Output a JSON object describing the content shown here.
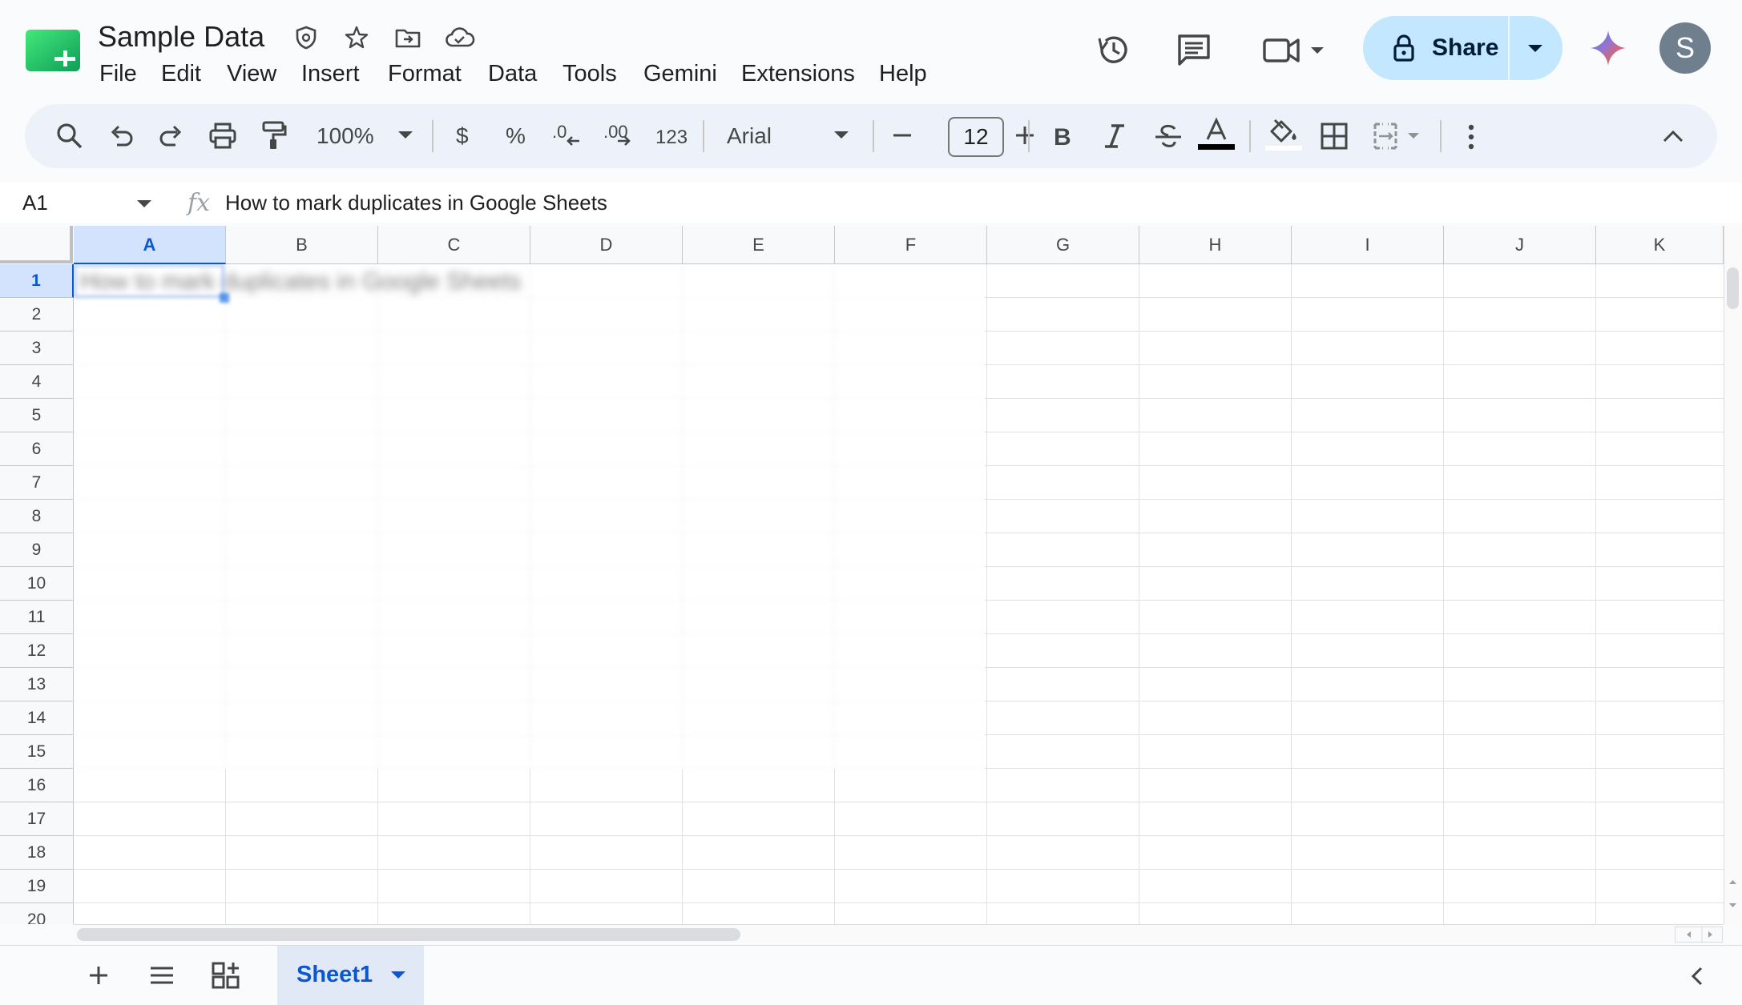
{
  "document": {
    "title": "Sample Data"
  },
  "menu": [
    "File",
    "Edit",
    "View",
    "Insert",
    "Format",
    "Data",
    "Tools",
    "Gemini",
    "Extensions",
    "Help"
  ],
  "share": {
    "label": "Share"
  },
  "user": {
    "initial": "S"
  },
  "toolbar": {
    "zoom": "100%",
    "currency": "$",
    "percent": "%",
    "number_format": "123",
    "font_family": "Arial",
    "font_size": "12",
    "text_color": "#000000"
  },
  "formula_bar": {
    "cell_ref": "A1",
    "fx": "fx",
    "content": "How to mark duplicates in Google Sheets"
  },
  "grid": {
    "columns": [
      "A",
      "B",
      "C",
      "D",
      "E",
      "F",
      "G",
      "H",
      "I",
      "J",
      "K"
    ],
    "rows": [
      "1",
      "2",
      "3",
      "4",
      "5",
      "6",
      "7",
      "8",
      "9",
      "10",
      "11",
      "12",
      "13",
      "14",
      "15",
      "16",
      "17",
      "18",
      "19",
      "20"
    ],
    "selected_column": "A",
    "selected_row": "1",
    "a1_text": "How to mark duplicates in Google Sheets"
  },
  "sheets": {
    "tabs": [
      {
        "label": "Sheet1",
        "active": true
      }
    ]
  },
  "colors": {
    "accent": "#0b57d0",
    "share_bg": "#c2e7ff",
    "app_bg": "#f9fbfd",
    "toolbar_bg": "#edf2fa",
    "sheets_green": "#188038"
  }
}
